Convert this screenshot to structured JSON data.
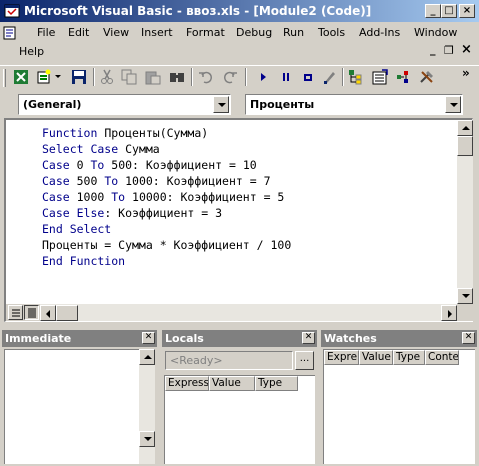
{
  "window": {
    "title": "Microsoft Visual Basic - ввоз.xls - [Module2 (Code)]",
    "controls": {
      "minimize": "_",
      "maximize": "□",
      "close": "×"
    },
    "mdi_controls": {
      "minimize": "_",
      "restore": "❐",
      "close": "×"
    }
  },
  "menu": [
    {
      "label": "File"
    },
    {
      "label": "Edit"
    },
    {
      "label": "View"
    },
    {
      "label": "Insert"
    },
    {
      "label": "Format"
    },
    {
      "label": "Debug"
    },
    {
      "label": "Run"
    },
    {
      "label": "Tools"
    },
    {
      "label": "Add-Ins"
    },
    {
      "label": "Window"
    },
    {
      "label": "Help"
    }
  ],
  "toolbar": {
    "icons": [
      "view-excel-icon",
      "insert-module-icon",
      "save-icon",
      "cut-icon",
      "copy-icon",
      "paste-icon",
      "find-icon",
      "undo-icon",
      "redo-icon",
      "run-icon",
      "break-icon",
      "reset-icon",
      "design-mode-icon",
      "project-explorer-icon",
      "properties-icon",
      "object-browser-icon",
      "toolbox-icon"
    ],
    "overflow": "»"
  },
  "combos": {
    "object": "(General)",
    "procedure": "Проценты"
  },
  "code": {
    "lines": [
      {
        "parts": [
          {
            "t": "Function",
            "kw": true
          },
          {
            "t": " Проценты(Сумма)",
            "kw": false
          }
        ]
      },
      {
        "parts": [
          {
            "t": "Select Case",
            "kw": true
          },
          {
            "t": " Сумма",
            "kw": false
          }
        ]
      },
      {
        "parts": [
          {
            "t": "Case",
            "kw": true
          },
          {
            "t": " 0 ",
            "kw": false
          },
          {
            "t": "To",
            "kw": true
          },
          {
            "t": " 500: Коэффициент = 10",
            "kw": false
          }
        ]
      },
      {
        "parts": [
          {
            "t": "Case",
            "kw": true
          },
          {
            "t": " 500 ",
            "kw": false
          },
          {
            "t": "To",
            "kw": true
          },
          {
            "t": " 1000: Коэффициент = 7",
            "kw": false
          }
        ]
      },
      {
        "parts": [
          {
            "t": "Case",
            "kw": true
          },
          {
            "t": " 1000 ",
            "kw": false
          },
          {
            "t": "To",
            "kw": true
          },
          {
            "t": " 10000: Коэффициент = 5",
            "kw": false
          }
        ]
      },
      {
        "parts": [
          {
            "t": "Case Else",
            "kw": true
          },
          {
            "t": ": Коэффициент = 3",
            "kw": false
          }
        ]
      },
      {
        "parts": [
          {
            "t": "End Select",
            "kw": true
          }
        ]
      },
      {
        "parts": [
          {
            "t": "Проценты = Сумма * Коэффициент / 100",
            "kw": false
          }
        ]
      },
      {
        "parts": [
          {
            "t": "End Function",
            "kw": true
          }
        ]
      }
    ]
  },
  "panels": {
    "immediate": {
      "title": "Immediate"
    },
    "locals": {
      "title": "Locals",
      "context": "<Ready>",
      "browse": "...",
      "columns": [
        "Express",
        "Value",
        "Type"
      ]
    },
    "watches": {
      "title": "Watches",
      "columns": [
        "Expre",
        "Value",
        "Type",
        "Conte"
      ]
    }
  },
  "colors": {
    "keyword": "#00008b",
    "titlebar_start": "#0a246a",
    "titlebar_end": "#a6caf0",
    "face": "#d4d0c8"
  }
}
